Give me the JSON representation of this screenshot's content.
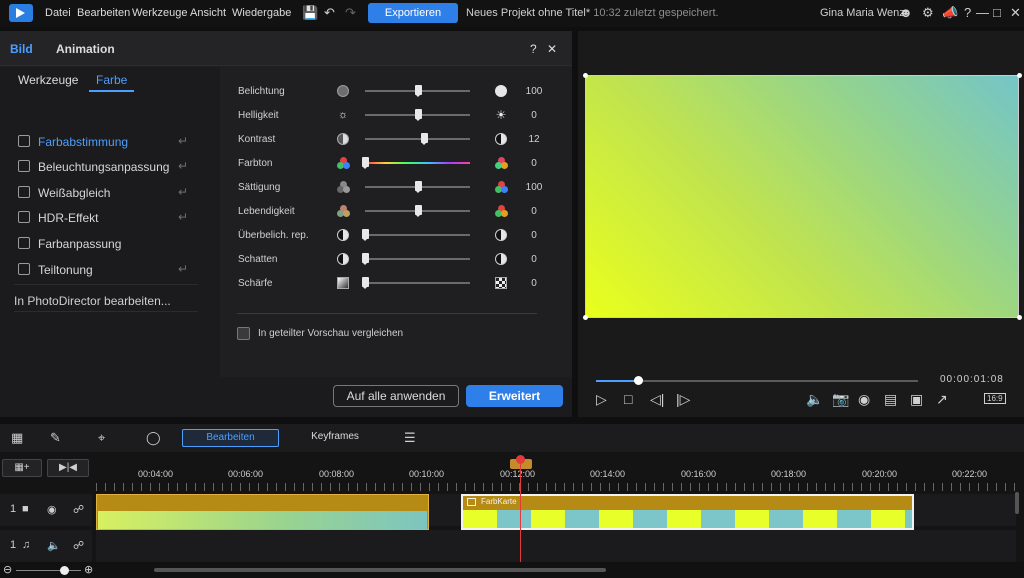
{
  "menu": {
    "items": [
      "Datei",
      "Bearbeiten",
      "Werkzeuge",
      "Ansicht",
      "Wiedergabe"
    ],
    "export_label": "Exportieren",
    "project_title": "Neues Projekt ohne Titel*",
    "saved_status": "10:32 zuletzt gespeichert.",
    "user_name": "Gina Maria Wenz"
  },
  "panel": {
    "tabs": [
      "Bild",
      "Animation"
    ],
    "subtabs": [
      "Werkzeuge",
      "Farbe"
    ],
    "features": [
      "Farbabstimmung",
      "Beleuchtungsanpassung",
      "Weißabgleich",
      "HDR-Effekt",
      "Farbanpassung",
      "Teiltonung"
    ],
    "photodirector_link": "In PhotoDirector bearbeiten...",
    "sliders": [
      {
        "name": "Belichtung",
        "value": 100
      },
      {
        "name": "Helligkeit",
        "value": 0
      },
      {
        "name": "Kontrast",
        "value": 12
      },
      {
        "name": "Farbton",
        "value": 0
      },
      {
        "name": "Sättigung",
        "value": 100
      },
      {
        "name": "Lebendigkeit",
        "value": 0
      },
      {
        "name": "Überbelich. rep.",
        "value": 0
      },
      {
        "name": "Schatten",
        "value": 0
      },
      {
        "name": "Schärfe",
        "value": 0
      }
    ],
    "compare_label": "In geteilter Vorschau vergleichen",
    "apply_all_label": "Auf alle anwenden",
    "advanced_label": "Erweitert"
  },
  "preview": {
    "timecode": "00:00:01:08",
    "aspect_ratio": "16:9",
    "progress": 0.13
  },
  "timeline": {
    "edit_tab": "Bearbeiten",
    "keyframes_tab": "Keyframes",
    "ticks": [
      "00:04:00",
      "00:06:00",
      "00:08:00",
      "00:10:00",
      "00:12:00",
      "00:14:00",
      "00:16:00",
      "00:18:00",
      "00:20:00",
      "00:22:00"
    ],
    "video_track_number": "1",
    "audio_track_number": "1",
    "clip2_title": "FarbKarte"
  },
  "colors": {
    "accent": "#2f7fe8",
    "playhead": "#e23a3a",
    "clip": "#b58a15"
  }
}
